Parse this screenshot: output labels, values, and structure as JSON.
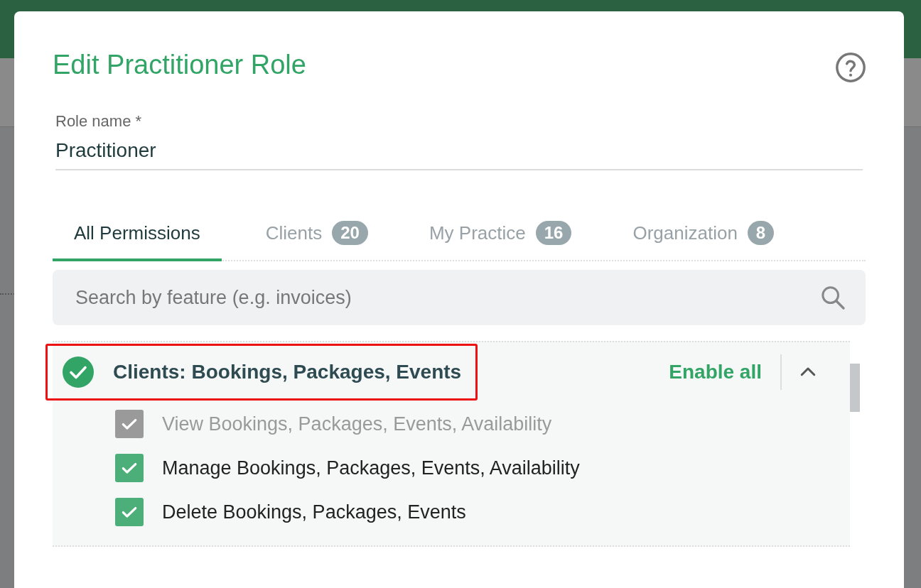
{
  "dialog": {
    "title": "Edit Practitioner Role",
    "role_name": {
      "label": "Role name *",
      "value": "Practitioner"
    },
    "tabs": [
      {
        "label": "All Permissions",
        "selected": true
      },
      {
        "label": "Clients",
        "count": "20",
        "selected": false
      },
      {
        "label": "My Practice",
        "count": "16",
        "selected": false
      },
      {
        "label": "Organization",
        "count": "8",
        "selected": false
      }
    ],
    "search": {
      "placeholder": "Search by feature (e.g. invoices)"
    },
    "groups": [
      {
        "title": "Clients: Bookings, Packages, Events",
        "enabled": true,
        "highlighted": true,
        "action": "Enable all",
        "expanded": true,
        "items": [
          {
            "label": "View Bookings, Packages, Events, Availability",
            "checked": true,
            "disabled": true
          },
          {
            "label": "Manage Bookings, Packages, Events, Availability",
            "checked": true,
            "disabled": false
          },
          {
            "label": "Delete Bookings, Packages, Events",
            "checked": true,
            "disabled": false
          }
        ]
      }
    ]
  }
}
